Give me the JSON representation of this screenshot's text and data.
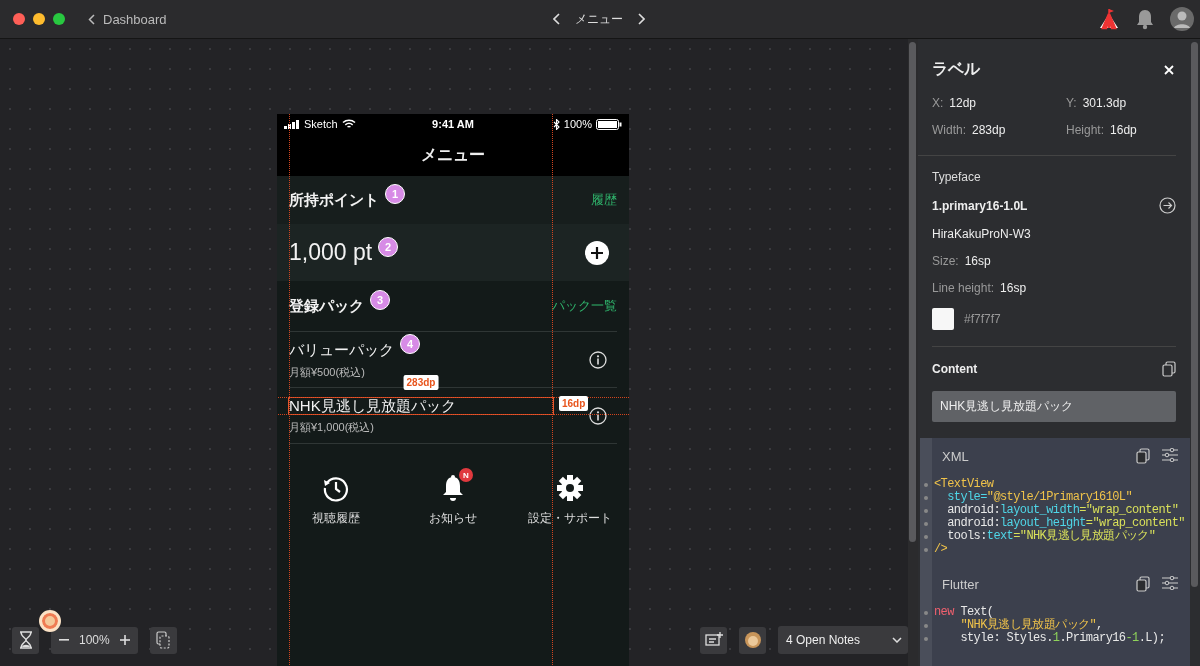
{
  "toolbar": {
    "back": "Dashboard",
    "title": "メニュー"
  },
  "phone": {
    "status": {
      "carrier": "Sketch",
      "time": "9:41 AM",
      "battery": "100%"
    },
    "nav_title": "メニュー",
    "points": {
      "header": "所持ポイント",
      "header_marker": "1",
      "link": "履歴",
      "value": "1,000 pt",
      "value_marker": "2"
    },
    "packs": {
      "header": "登録パック",
      "header_marker": "3",
      "link": "パック一覧",
      "items": [
        {
          "name": "バリューパック",
          "price": "月額¥500(税込)",
          "marker": "4",
          "selected": false
        },
        {
          "name": "NHK見逃し見放題パック",
          "price": "月額¥1,000(税込)",
          "selected": true
        }
      ]
    },
    "tabs": [
      {
        "label": "視聴履歴",
        "kind": "history"
      },
      {
        "label": "お知らせ",
        "kind": "bell",
        "badge": "N"
      },
      {
        "label": "設定・サポート",
        "kind": "gear"
      }
    ]
  },
  "selection": {
    "width": "283dp",
    "height": "16dp"
  },
  "zoom": "100%",
  "notes": "4 Open Notes",
  "inspector": {
    "title": "ラベル",
    "props": [
      {
        "label": "X:",
        "value": "12dp"
      },
      {
        "label": "Y:",
        "value": "301.3dp"
      },
      {
        "label": "Width:",
        "value": "283dp"
      },
      {
        "label": "Height:",
        "value": "16dp"
      }
    ],
    "typeface": {
      "heading": "Typeface",
      "style": "1.primary16-1.0L",
      "font": "HiraKakuProN-W3",
      "size_label": "Size:",
      "size": "16sp",
      "lh_label": "Line height:",
      "line_height": "16sp",
      "color_text": "#f7f7f7"
    },
    "content": {
      "heading": "Content",
      "value": "NHK見逃し見放題パック"
    },
    "code": [
      {
        "heading": "XML",
        "lines": [
          [
            {
              "text": "<TextView",
              "kind": "tag"
            }
          ],
          [
            {
              "text": "  style=",
              "kind": "attr"
            },
            {
              "text": "\"@style/1Primary1610L\"",
              "kind": "tag"
            }
          ],
          [
            {
              "text": "  android:",
              "kind": "plain"
            },
            {
              "text": "layout_width",
              "kind": "attr"
            },
            {
              "text": "=\"wrap_content\"",
              "kind": "str"
            }
          ],
          [
            {
              "text": "  android:",
              "kind": "plain"
            },
            {
              "text": "layout_height",
              "kind": "attr"
            },
            {
              "text": "=\"wrap_content\"",
              "kind": "str"
            }
          ],
          [
            {
              "text": "  tools:",
              "kind": "plain"
            },
            {
              "text": "text",
              "kind": "attr"
            },
            {
              "text": "=\"NHK見逃し見放題パック\"",
              "kind": "str"
            }
          ],
          [
            {
              "text": "/>",
              "kind": "tag"
            }
          ]
        ]
      },
      {
        "heading": "Flutter",
        "lines": [
          [
            {
              "text": "new",
              "kind": "kw"
            },
            {
              "text": " Text(",
              "kind": "plain"
            }
          ],
          [
            {
              "text": "    \"NHK見逃し見放題パック\"",
              "kind": "tag"
            },
            {
              "text": ",",
              "kind": "plain"
            }
          ],
          [
            {
              "text": "    style: Styles.",
              "kind": "plain"
            },
            {
              "text": "1",
              "kind": "num"
            },
            {
              "text": ".Primary16",
              "kind": "plain"
            },
            {
              "text": "-1",
              "kind": "num"
            },
            {
              "text": ".L);",
              "kind": "plain"
            }
          ]
        ]
      }
    ]
  }
}
